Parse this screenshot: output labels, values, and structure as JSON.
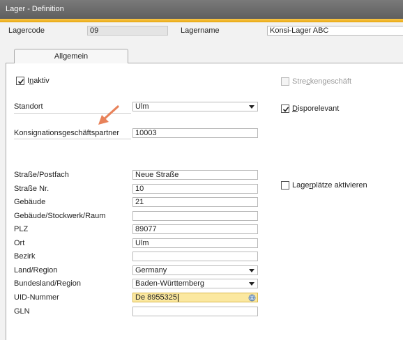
{
  "window": {
    "title": "Lager - Definition"
  },
  "header": {
    "lagercode_label": "Lagercode",
    "lagercode_value": "09",
    "lagername_label": "Lagername",
    "lagername_value": "Konsi-Lager ABC"
  },
  "tabs": [
    {
      "label": "Allgemein"
    }
  ],
  "checkboxes": {
    "inaktiv": {
      "prefix": "I",
      "mnemonic": "n",
      "rest": "aktiv",
      "checked": true
    },
    "streckengeschaeft": {
      "prefix": "Stre",
      "mnemonic": "c",
      "rest": "kengeschäft",
      "checked": false,
      "disabled": true
    },
    "disporelevant": {
      "prefix": "",
      "mnemonic": "D",
      "rest": "isporelevant",
      "checked": true
    },
    "lagerplaetze": {
      "prefix": "Lage",
      "mnemonic": "r",
      "rest": "plätze aktivieren",
      "checked": false
    }
  },
  "fields": {
    "standort": {
      "label": "Standort",
      "value": "Ulm"
    },
    "konsignation": {
      "label": "Konsignationsgeschäftspartner",
      "value": "10003"
    },
    "strasse_postfach": {
      "label": "Straße/Postfach",
      "value": "Neue Straße"
    },
    "strasse_nr": {
      "label": "Straße Nr.",
      "value": "10"
    },
    "gebaeude": {
      "label": "Gebäude",
      "value": "21"
    },
    "gebaeude_stockwerk": {
      "label": "Gebäude/Stockwerk/Raum",
      "value": ""
    },
    "plz": {
      "label": "PLZ",
      "value": "89077"
    },
    "ort": {
      "label": "Ort",
      "value": "Ulm"
    },
    "bezirk": {
      "label": "Bezirk",
      "value": ""
    },
    "land_region": {
      "label": "Land/Region",
      "value": "Germany"
    },
    "bundesland": {
      "label": "Bundesland/Region",
      "value": "Baden-Württemberg"
    },
    "uid_nummer": {
      "label": "UID-Nummer",
      "value": "De 8955325"
    },
    "gln": {
      "label": "GLN",
      "value": ""
    }
  },
  "colors": {
    "accent": "#f0b429",
    "arrow": "#e8825a",
    "active_field": "#fbe8a0"
  }
}
